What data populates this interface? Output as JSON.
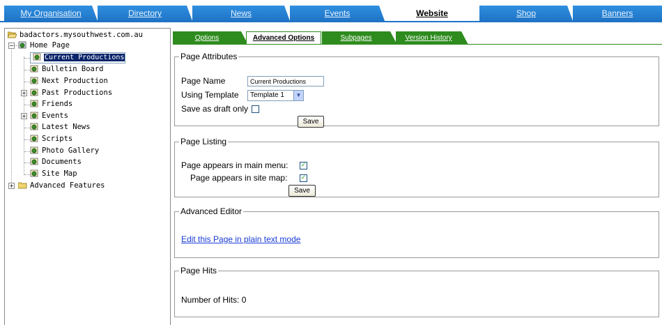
{
  "topnav": {
    "tabs": [
      {
        "label": "My Organisation"
      },
      {
        "label": "Directory"
      },
      {
        "label": "News"
      },
      {
        "label": "Events"
      },
      {
        "label": "Website"
      },
      {
        "label": "Shop"
      },
      {
        "label": "Banners"
      }
    ],
    "active": "Website"
  },
  "tree": {
    "root": "badactors.mysouthwest.com.au",
    "home": "Home Page",
    "children": [
      "Current Productions",
      "Bulletin Board",
      "Next Production",
      "Past Productions",
      "Friends",
      "Events",
      "Latest News",
      "Scripts",
      "Photo Gallery",
      "Documents",
      "Site Map"
    ],
    "advanced": "Advanced Features",
    "selected": "Current Productions"
  },
  "subtabs": [
    {
      "label": "Options"
    },
    {
      "label": "Advanced Options"
    },
    {
      "label": "Subpages"
    },
    {
      "label": "Version History"
    }
  ],
  "page_attributes": {
    "legend": "Page Attributes",
    "page_name_label": "Page Name",
    "page_name_value": "Current Productions",
    "template_label": "Using Template",
    "template_value": "Template 1",
    "draft_label": "Save as draft only",
    "draft_checked": false,
    "save_label": "Save"
  },
  "page_listing": {
    "legend": "Page Listing",
    "main_menu_label": "Page appears in main menu:",
    "main_menu_checked": true,
    "site_map_label": "Page appears in site map:",
    "site_map_checked": true,
    "save_label": "Save"
  },
  "advanced_editor": {
    "legend": "Advanced Editor",
    "link": "Edit this Page in plain text mode"
  },
  "page_hits": {
    "legend": "Page Hits",
    "text": "Number of Hits: 0"
  },
  "colors": {
    "nav_blue": "#1f74c6",
    "tab_green": "#2e8b1e",
    "selection": "#0a246a",
    "link": "#1a3cd8"
  }
}
